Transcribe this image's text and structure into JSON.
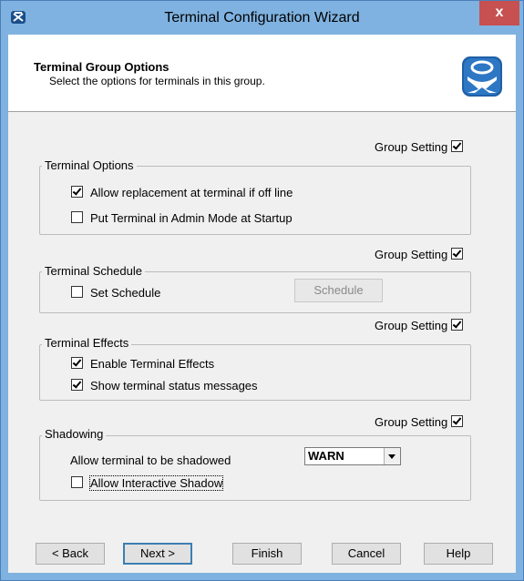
{
  "window": {
    "title": "Terminal Configuration Wizard",
    "close_label": "x"
  },
  "header": {
    "title": "Terminal Group Options",
    "subtitle": "Select the options for terminals in this group."
  },
  "group_setting_label": "Group Setting",
  "groups": {
    "terminal_options": {
      "legend": "Terminal Options",
      "group_setting_checked": true,
      "options": [
        {
          "label": "Allow replacement at terminal if off line",
          "checked": true
        },
        {
          "label": "Put Terminal in Admin Mode at Startup",
          "checked": false
        }
      ]
    },
    "terminal_schedule": {
      "legend": "Terminal Schedule",
      "group_setting_checked": true,
      "option": {
        "label": "Set Schedule",
        "checked": false
      },
      "schedule_button": "Schedule"
    },
    "terminal_effects": {
      "legend": "Terminal Effects",
      "group_setting_checked": true,
      "options": [
        {
          "label": "Enable Terminal Effects",
          "checked": true
        },
        {
          "label": "Show terminal status messages",
          "checked": true
        }
      ]
    },
    "shadowing": {
      "legend": "Shadowing",
      "group_setting_checked": true,
      "allow_label": "Allow terminal to be shadowed",
      "shadow_mode": "WARN",
      "interactive": {
        "label": "Allow Interactive Shadow",
        "checked": false
      }
    }
  },
  "buttons": {
    "back": "< Back",
    "next": "Next >",
    "finish": "Finish",
    "cancel": "Cancel",
    "help": "Help"
  },
  "colors": {
    "titlebar": "#7fb2e0",
    "close": "#c75050"
  }
}
